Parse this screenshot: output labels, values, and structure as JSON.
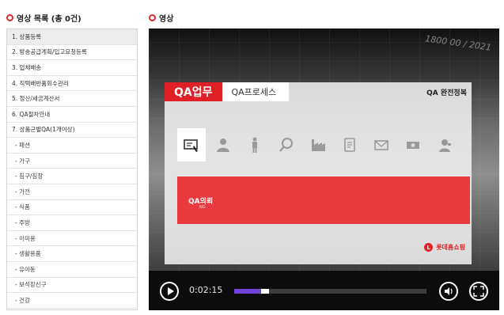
{
  "list": {
    "header": "영상 목록 (총 0건)",
    "items": [
      {
        "label": "1. 상품등록",
        "sub": false,
        "active": true
      },
      {
        "label": "2. 방송공급계획/입고요청등록",
        "sub": false,
        "active": false
      },
      {
        "label": "3. 업체배송",
        "sub": false,
        "active": false
      },
      {
        "label": "4. 직택배반품회수관리",
        "sub": false,
        "active": false
      },
      {
        "label": "5. 정산/세금계산서",
        "sub": false,
        "active": false
      },
      {
        "label": "6. QA절차안내",
        "sub": false,
        "active": false
      },
      {
        "label": "7. 상품군별QA(1개이상)",
        "sub": false,
        "active": false
      },
      {
        "label": "- 패션",
        "sub": true,
        "active": false
      },
      {
        "label": "- 가구",
        "sub": true,
        "active": false
      },
      {
        "label": "- 침구/침장",
        "sub": true,
        "active": false
      },
      {
        "label": "- 가전",
        "sub": true,
        "active": false
      },
      {
        "label": "- 식품",
        "sub": true,
        "active": false
      },
      {
        "label": "- 주방",
        "sub": true,
        "active": false
      },
      {
        "label": "- 이미용",
        "sub": true,
        "active": false
      },
      {
        "label": "- 생활용품",
        "sub": true,
        "active": false
      },
      {
        "label": "- 유아동",
        "sub": true,
        "active": false
      },
      {
        "label": "- 보석장신구",
        "sub": true,
        "active": false
      },
      {
        "label": "- 건강",
        "sub": true,
        "active": false
      }
    ]
  },
  "video": {
    "header": "영상",
    "stamp": "1800 00 / 2021",
    "qa_title": "QA업무",
    "qa_tab": "QA프로세스",
    "qa_right": "QA 완전정복",
    "icons": [
      "document-pen-icon",
      "person-icon",
      "standing-person-icon",
      "magnifier-icon",
      "factory-icon",
      "clipboard-icon",
      "envelope-icon",
      "cash-icon",
      "support-person-icon"
    ],
    "active_icon": 0,
    "red_title": "QA의뢰",
    "red_sub": "NG",
    "brand": "롯데홈쇼핑",
    "brand_mark": "L",
    "time": "0:02:15",
    "progress_played": 0.14,
    "progress_buffered": 0.04
  }
}
